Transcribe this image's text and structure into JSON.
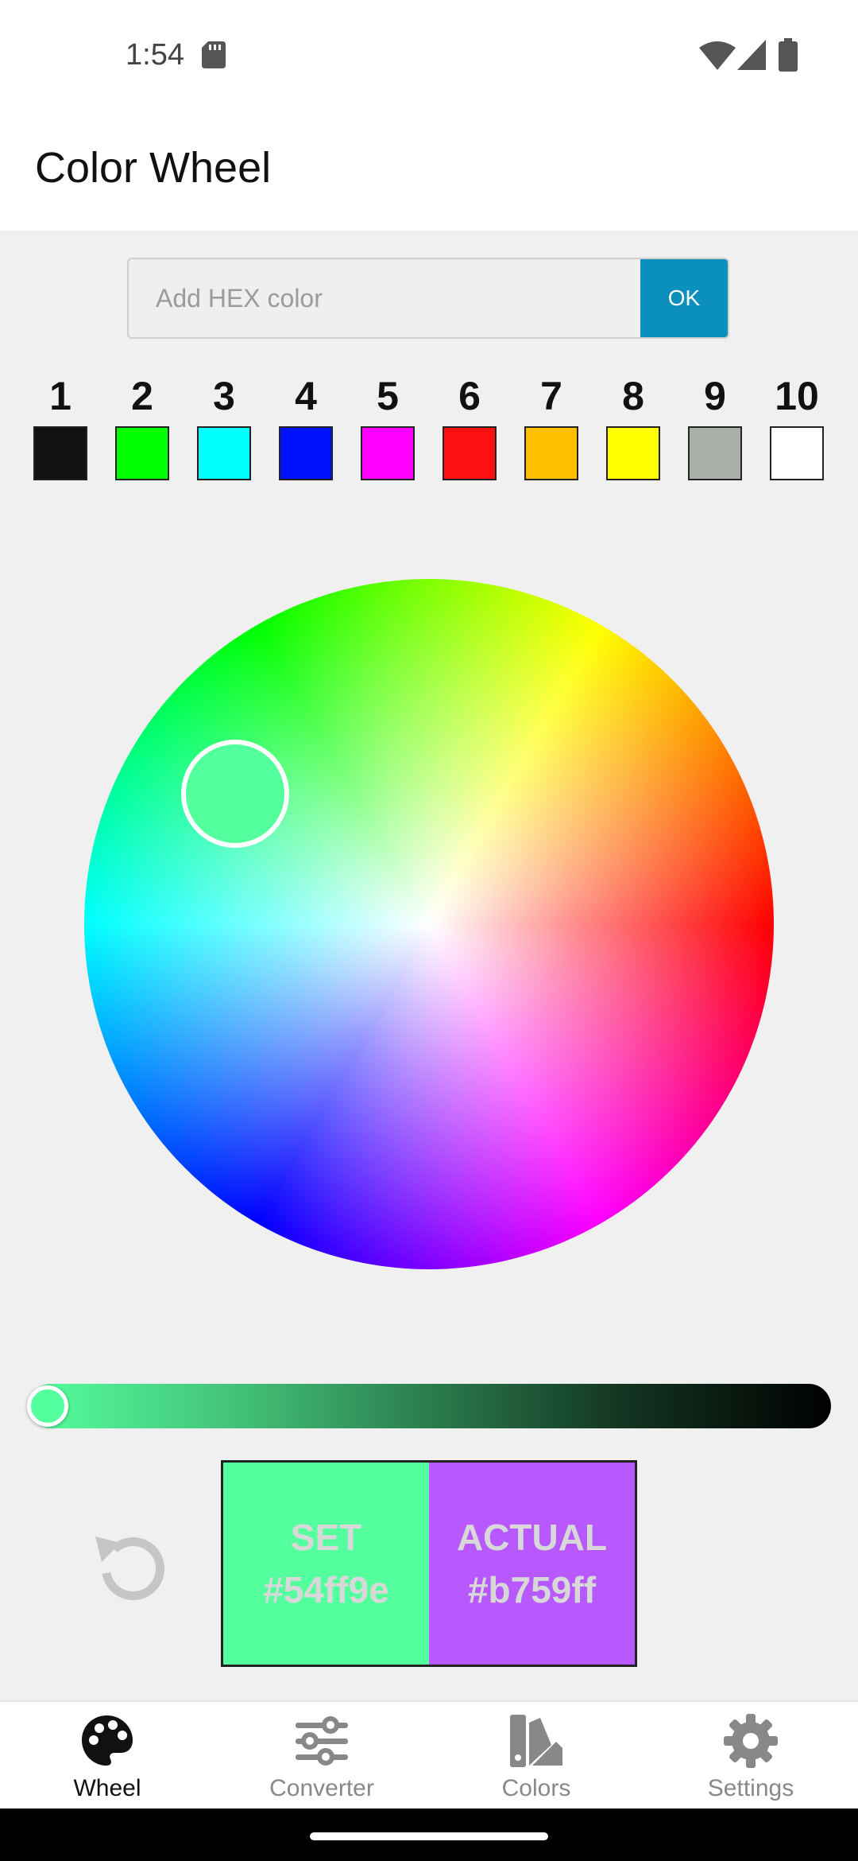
{
  "status_bar": {
    "time": "1:54"
  },
  "app_bar": {
    "title": "Color Wheel"
  },
  "hex_input": {
    "placeholder": "Add HEX color",
    "value": "",
    "ok_label": "OK"
  },
  "swatches": [
    {
      "number": "1",
      "color": "#111111"
    },
    {
      "number": "2",
      "color": "#00ff00"
    },
    {
      "number": "3",
      "color": "#00ffff"
    },
    {
      "number": "4",
      "color": "#0011ff"
    },
    {
      "number": "5",
      "color": "#ff00ff"
    },
    {
      "number": "6",
      "color": "#ff1111"
    },
    {
      "number": "7",
      "color": "#ffc000"
    },
    {
      "number": "8",
      "color": "#ffff00"
    },
    {
      "number": "9",
      "color": "#a8b0a8"
    },
    {
      "number": "10",
      "color": "#ffffff"
    }
  ],
  "wheel": {
    "selected_color": "#54ff9e"
  },
  "brightness_slider": {
    "value_fraction": 0.0,
    "start_color": "#54ff9e",
    "end_color": "#000000"
  },
  "compare": {
    "set_label": "SET",
    "set_hex": "#54ff9e",
    "actual_label": "ACTUAL",
    "actual_hex": "#b759ff"
  },
  "bottom_nav": {
    "items": [
      {
        "label": "Wheel",
        "icon": "palette-icon",
        "active": true
      },
      {
        "label": "Converter",
        "icon": "sliders-icon",
        "active": false
      },
      {
        "label": "Colors",
        "icon": "swatch-book-icon",
        "active": false
      },
      {
        "label": "Settings",
        "icon": "gear-icon",
        "active": false
      }
    ]
  },
  "colors": {
    "accent": "#0b8fbc",
    "background": "#f0f0f0",
    "inactive_nav": "#888888",
    "active_nav": "#111111"
  }
}
